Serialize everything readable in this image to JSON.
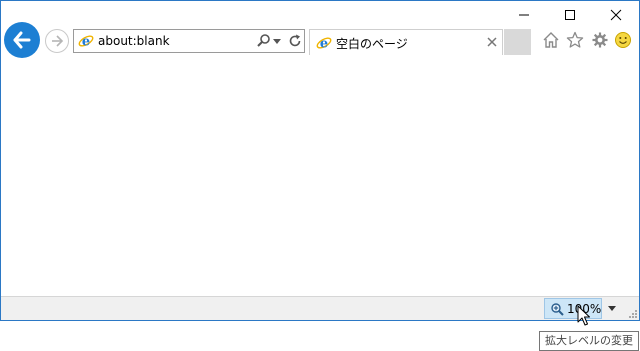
{
  "address_bar": {
    "url": "about:blank"
  },
  "tabs": [
    {
      "title": "空白のページ"
    }
  ],
  "status_bar": {
    "zoom_level": "100%"
  },
  "tooltip": {
    "text": "拡大レベルの変更"
  },
  "colors": {
    "accent": "#1d7fd3",
    "window_border": "#2b78c5",
    "zoom_highlight": "#cde6f7"
  },
  "icons": {
    "back": "back-arrow-icon",
    "forward": "forward-arrow-icon",
    "page": "ie-page-icon",
    "search": "search-icon",
    "refresh": "refresh-icon",
    "home": "home-icon",
    "favorites": "star-icon",
    "tools": "gear-icon",
    "feedback": "smiley-icon"
  }
}
